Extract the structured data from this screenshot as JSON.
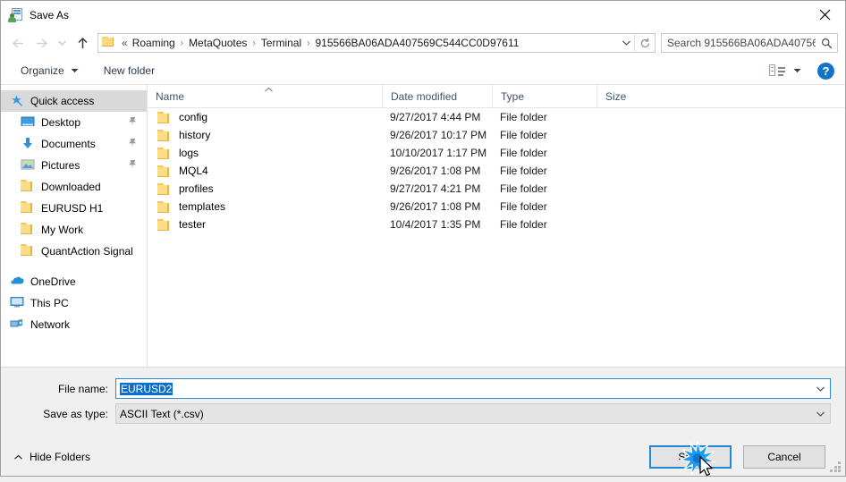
{
  "window": {
    "title": "Save As",
    "app_icon": "save-as-icon",
    "close_label": "✕"
  },
  "nav": {
    "back_icon": "back-arrow-icon",
    "forward_icon": "forward-arrow-icon",
    "recent_icon": "recent-locations-icon",
    "up_icon": "up-arrow-icon",
    "address": {
      "folder_icon": "folder-icon",
      "prefix": "«",
      "crumbs": [
        {
          "label": "Roaming"
        },
        {
          "label": "MetaQuotes"
        },
        {
          "label": "Terminal"
        },
        {
          "label": "915566BA06ADA407569C544CC0D97611"
        }
      ],
      "separator": "›",
      "dropdown_icon": "chevron-down-icon",
      "refresh_icon": "refresh-icon"
    },
    "search": {
      "placeholder": "Search 915566BA06ADA40756...",
      "icon": "search-icon"
    }
  },
  "toolbar": {
    "organize_label": "Organize",
    "organize_caret": "caret-down-icon",
    "new_folder_label": "New folder",
    "view_icon": "view-options-icon",
    "view_caret": "caret-down-icon",
    "help_label": "?",
    "help_icon": "help-icon"
  },
  "sidebar": {
    "items": [
      {
        "label": "Quick access",
        "icon": "star-pin-icon",
        "selected": true,
        "pinned": false,
        "root": true
      },
      {
        "label": "Desktop",
        "icon": "desktop-icon",
        "selected": false,
        "pinned": true,
        "root": false
      },
      {
        "label": "Documents",
        "icon": "documents-icon",
        "selected": false,
        "pinned": true,
        "root": false
      },
      {
        "label": "Pictures",
        "icon": "pictures-icon",
        "selected": false,
        "pinned": true,
        "root": false
      },
      {
        "label": "Downloaded",
        "icon": "folder-icon",
        "selected": false,
        "pinned": false,
        "root": false
      },
      {
        "label": "EURUSD H1",
        "icon": "folder-icon",
        "selected": false,
        "pinned": false,
        "root": false
      },
      {
        "label": "My Work",
        "icon": "folder-icon",
        "selected": false,
        "pinned": false,
        "root": false
      },
      {
        "label": "QuantAction Signal",
        "icon": "folder-icon",
        "selected": false,
        "pinned": false,
        "root": false
      }
    ],
    "roots": [
      {
        "label": "OneDrive",
        "icon": "onedrive-cloud-icon"
      },
      {
        "label": "This PC",
        "icon": "this-pc-icon"
      },
      {
        "label": "Network",
        "icon": "network-icon"
      }
    ]
  },
  "filelist": {
    "columns": [
      {
        "label": "Name"
      },
      {
        "label": "Date modified"
      },
      {
        "label": "Type"
      },
      {
        "label": "Size"
      }
    ],
    "sort_icon": "sort-ascending-icon",
    "rows": [
      {
        "name": "config",
        "date": "9/27/2017 4:44 PM",
        "type": "File folder",
        "size": "",
        "icon": "folder-icon"
      },
      {
        "name": "history",
        "date": "9/26/2017 10:17 PM",
        "type": "File folder",
        "size": "",
        "icon": "folder-icon"
      },
      {
        "name": "logs",
        "date": "10/10/2017 1:17 PM",
        "type": "File folder",
        "size": "",
        "icon": "folder-icon"
      },
      {
        "name": "MQL4",
        "date": "9/26/2017 1:08 PM",
        "type": "File folder",
        "size": "",
        "icon": "folder-icon"
      },
      {
        "name": "profiles",
        "date": "9/27/2017 4:21 PM",
        "type": "File folder",
        "size": "",
        "icon": "folder-icon"
      },
      {
        "name": "templates",
        "date": "9/26/2017 1:08 PM",
        "type": "File folder",
        "size": "",
        "icon": "folder-icon"
      },
      {
        "name": "tester",
        "date": "10/4/2017 1:35 PM",
        "type": "File folder",
        "size": "",
        "icon": "folder-icon"
      }
    ]
  },
  "form": {
    "filename_label": "File name:",
    "filename_value": "EURUSD2",
    "filename_dropdown_icon": "chevron-down-icon",
    "savetype_label": "Save as type:",
    "savetype_value": "ASCII Text (*.csv)",
    "savetype_dropdown_icon": "chevron-down-icon"
  },
  "footer": {
    "hide_folders_label": "Hide Folders",
    "hide_folders_icon": "caret-up-icon",
    "save_label": "Save",
    "cancel_label": "Cancel",
    "click_effect_icon": "click-burst-icon",
    "cursor_icon": "mouse-pointer-icon",
    "resize_grip_icon": "resize-grip-icon"
  },
  "colors": {
    "accent_blue": "#1e8ad6",
    "selection_blue": "#0b6fcb",
    "folder_yellow": "#fcdd86",
    "help_blue": "#1573c6",
    "burst_blue": "#1b9bf0"
  }
}
